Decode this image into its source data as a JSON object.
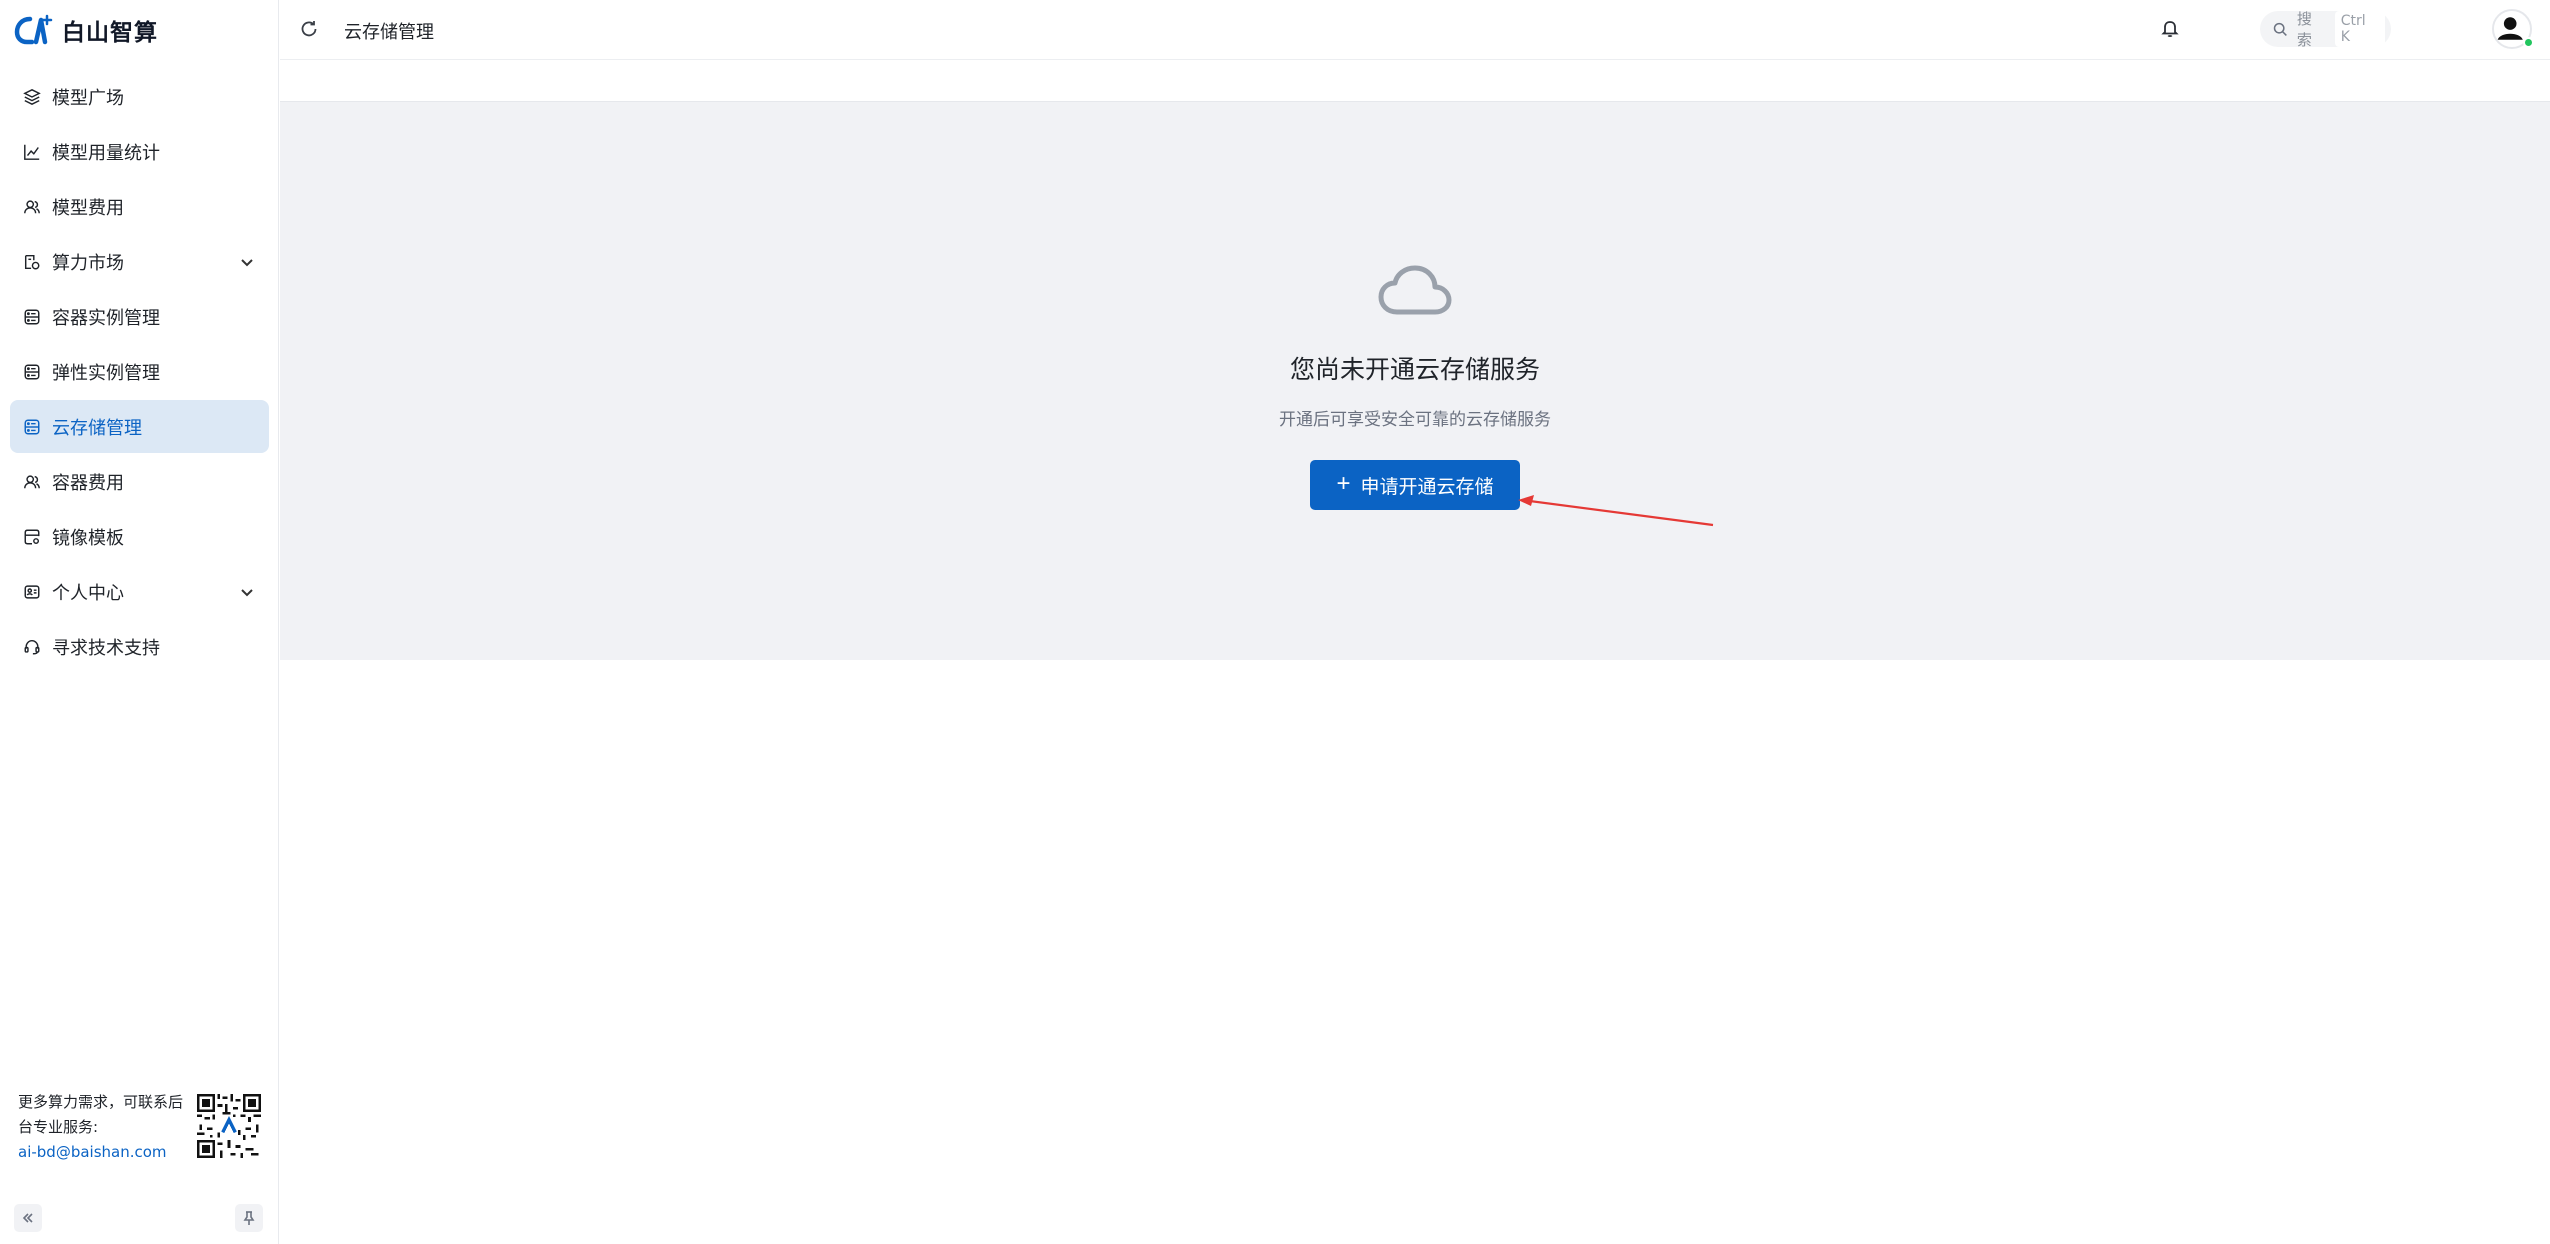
{
  "brand": {
    "name": "白山智算"
  },
  "sidebar": {
    "items": [
      {
        "label": "模型广场",
        "icon": "layers-icon",
        "active": false,
        "expandable": false
      },
      {
        "label": "模型用量统计",
        "icon": "line-chart-icon",
        "active": false,
        "expandable": false
      },
      {
        "label": "模型费用",
        "icon": "users-icon",
        "active": false,
        "expandable": false
      },
      {
        "label": "算力市场",
        "icon": "market-icon",
        "active": false,
        "expandable": true
      },
      {
        "label": "容器实例管理",
        "icon": "server-icon",
        "active": false,
        "expandable": false
      },
      {
        "label": "弹性实例管理",
        "icon": "server-icon",
        "active": false,
        "expandable": false
      },
      {
        "label": "云存储管理",
        "icon": "server-icon",
        "active": true,
        "expandable": false
      },
      {
        "label": "容器费用",
        "icon": "users-icon",
        "active": false,
        "expandable": false
      },
      {
        "label": "镜像模板",
        "icon": "image-settings-icon",
        "active": false,
        "expandable": false
      },
      {
        "label": "个人中心",
        "icon": "id-card-icon",
        "active": false,
        "expandable": true
      },
      {
        "label": "寻求技术支持",
        "icon": "headset-icon",
        "active": false,
        "expandable": false
      }
    ],
    "contact": {
      "line1": "更多算力需求，可联系后台专业服务:",
      "email": "ai-bd@baishan.com"
    }
  },
  "header": {
    "breadcrumb": "云存储管理",
    "search_placeholder": "搜索",
    "search_shortcut": "Ctrl K"
  },
  "main": {
    "empty_title": "您尚未开通云存储服务",
    "empty_subtitle": "开通后可享受安全可靠的云存储服务",
    "apply_button_label": "申请开通云存储"
  },
  "colors": {
    "primary": "#0b63c4",
    "active_bg": "#dce8f5",
    "panel_bg": "#f1f2f5",
    "annotation_arrow": "#e53935"
  }
}
